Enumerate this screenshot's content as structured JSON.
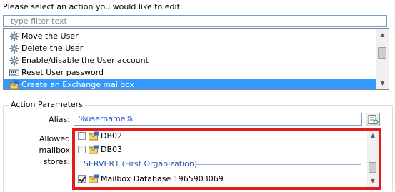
{
  "prompt": "Please select an action you would like to edit:",
  "filter": {
    "placeholder": "type filter text",
    "value": ""
  },
  "actions": {
    "items": [
      {
        "label": "Move the User",
        "icon": "gear-icon",
        "selected": false
      },
      {
        "label": "Delete the User",
        "icon": "gear-icon",
        "selected": false
      },
      {
        "label": "Enable/disable the User account",
        "icon": "gear-icon",
        "selected": false
      },
      {
        "label": "Reset User password",
        "icon": "password-icon",
        "selected": false
      },
      {
        "label": "Create an Exchange mailbox",
        "icon": "exchange-mailbox-icon",
        "selected": true
      }
    ]
  },
  "params": {
    "legend": "Action Parameters",
    "alias_label": "Alias:",
    "alias_value": "%username%",
    "alias_button_icon": "insert-variable-icon",
    "stores_label_line1": "Allowed mailbox",
    "stores_label_line2": "stores:"
  },
  "stores": {
    "items": [
      {
        "label": "DB02",
        "checked": false,
        "icon": "database-icon"
      },
      {
        "label": "DB03",
        "checked": false,
        "icon": "database-icon"
      }
    ],
    "server": "SERVER1 (First Organization)",
    "server_items": [
      {
        "label": "Mailbox Database 1965903069",
        "checked": true,
        "icon": "database-icon"
      }
    ]
  },
  "colors": {
    "selection": "#3399ff",
    "highlight_frame": "#e41b1b",
    "alias_text": "#1f4fd8",
    "server_text": "#2a5db0"
  }
}
